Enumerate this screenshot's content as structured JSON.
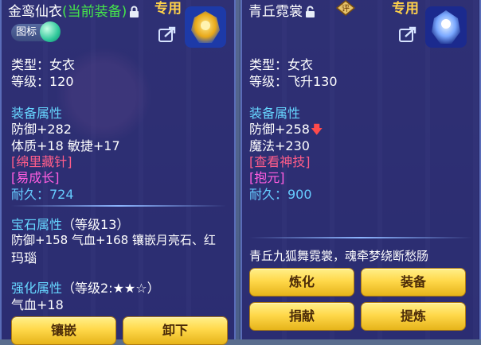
{
  "left": {
    "title": "金鸾仙衣",
    "current_tag": "(当前装备)",
    "exclusive": "专用",
    "badge_label": "图标",
    "type": "类型：女衣",
    "level": "等级：120",
    "section_attrs": "装备属性",
    "attr1": "防御+282",
    "attr2": "体质+18 敏捷+17",
    "tag1": "[绵里藏针]",
    "tag2": "[易成长]",
    "durability": "耐久：724",
    "gem_section": "宝石属性",
    "gem_level": "（等级13）",
    "gem_line1": "防御+158 气血+168 镶嵌月亮石、红",
    "gem_line2": "玛瑙",
    "enhance_section": "强化属性",
    "enhance_level": "（等级2:★★☆）",
    "enhance_line1": "气血+18",
    "buttons": [
      "镶嵌",
      "卸下"
    ]
  },
  "right": {
    "title": "青丘霓裳",
    "exclusive": "专用",
    "type": "类型：女衣",
    "level": "等级：飞升130",
    "section_attrs": "装备属性",
    "attr1": "防御+258",
    "attr2": "魔法+230",
    "tag1": "[查看神技]",
    "tag2": "[抱元]",
    "durability": "耐久：900",
    "description": "青丘九狐舞霓裳，魂牵梦绕断愁肠",
    "buttons": [
      "炼化",
      "装备",
      "捐献",
      "提炼"
    ]
  },
  "colors": {
    "panel_bg": "#241e6e",
    "section": "#66d6ff",
    "current_tag": "#46e84a",
    "button": "#ffd84a"
  }
}
